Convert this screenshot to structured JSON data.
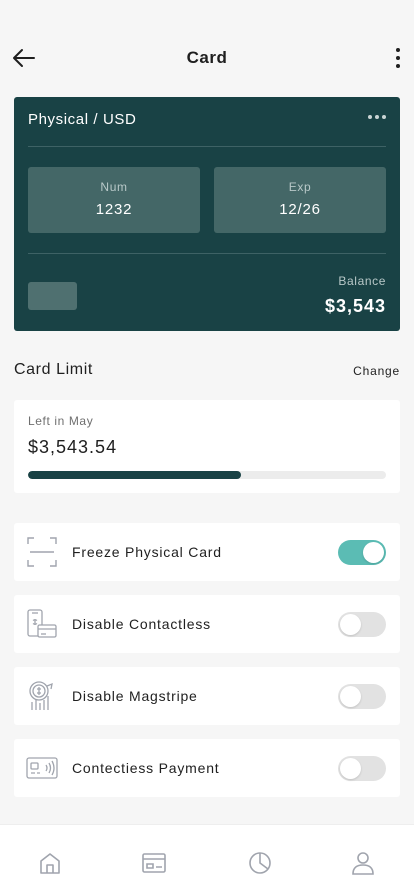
{
  "header": {
    "title": "Card"
  },
  "card": {
    "type_label": "Physical / USD",
    "num_label": "Num",
    "num_value": "1232",
    "exp_label": "Exp",
    "exp_value": "12/26",
    "balance_label": "Balance",
    "balance_value": "$3,543"
  },
  "limit": {
    "title": "Card Limit",
    "change_label": "Change",
    "left_label": "Left in May",
    "left_value": "$3,543.54",
    "progress_fraction": 0.595
  },
  "settings": [
    {
      "label": "Freeze Physical Card",
      "icon": "freeze-frame-icon",
      "enabled": true
    },
    {
      "label": "Disable Contactless",
      "icon": "phone-card-icon",
      "enabled": false
    },
    {
      "label": "Disable Magstripe",
      "icon": "coin-chart-icon",
      "enabled": false
    },
    {
      "label": "Contectiess Payment",
      "icon": "contactless-card-icon",
      "enabled": false
    }
  ],
  "tabs": [
    {
      "name": "home-icon"
    },
    {
      "name": "wallet-icon"
    },
    {
      "name": "pie-chart-icon"
    },
    {
      "name": "profile-icon"
    }
  ],
  "colors": {
    "card_bg": "#194245",
    "accent_toggle": "#5bbcb4",
    "icon_gray": "#a0a4ad"
  }
}
